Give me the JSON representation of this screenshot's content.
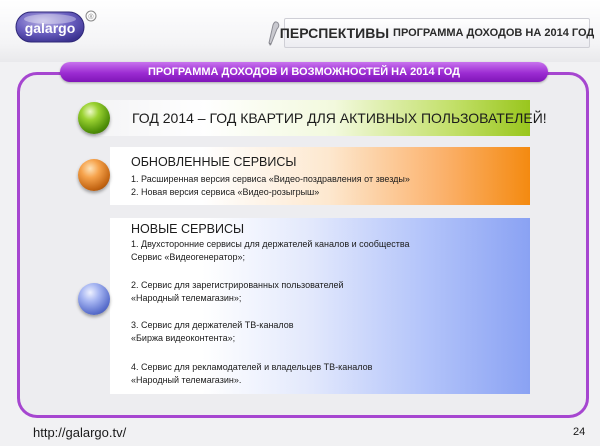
{
  "header": {
    "logo_text": "galargo",
    "title_main": "ПЕРСПЕКТИВЫ",
    "title_sub": "ПРОГРАММА ДОХОДОВ НА 2014 ГОД"
  },
  "banner": "ПРОГРАММА ДОХОДОВ И ВОЗМОЖНОСТЕЙ НА 2014 ГОД",
  "items": [
    {
      "icon": "green-bullet-icon",
      "color": "#99c61d",
      "title": "ГОД 2014 – ГОД КВАРТИР ДЛЯ АКТИВНЫХ ПОЛЬЗОВАТЕЛЕЙ!"
    },
    {
      "icon": "orange-bullet-icon",
      "color": "#f48a10",
      "title": "ОБНОВЛЕННЫЕ СЕРВИСЫ",
      "lines": [
        "1. Расширенная версия сервиса «Видео-поздравления от звезды»",
        "2. Новая версия сервиса «Видео-розыгрыш»"
      ]
    },
    {
      "icon": "blue-bullet-icon",
      "color": "#8aa2f3",
      "title": "НОВЫЕ СЕРВИСЫ",
      "lines": [
        "1. Двухсторонние сервисы для держателей каналов и сообщества",
        "Сервис «Видеогенератор»;",
        "2. Сервис для зарегистрированных пользователей",
        "«Народный телемагазин»;",
        "3. Сервис для держателей ТВ-каналов",
        "«Биржа видеоконтента»;",
        "4. Сервис для рекламодателей и владельцев ТВ-каналов",
        "«Народный телемагазин»."
      ]
    }
  ],
  "footer": {
    "url": "http://galargo.tv/",
    "page": "24"
  },
  "colors": {
    "accent_purple": "#a646d0",
    "banner_purple": "#9c2cd2"
  }
}
